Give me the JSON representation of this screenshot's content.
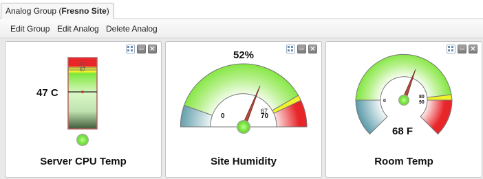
{
  "tab": {
    "prefix": "Analog Group (",
    "site": "Fresno Site",
    "suffix": ")"
  },
  "menu": {
    "edit_group": "Edit Group",
    "edit_analog": "Edit Analog",
    "delete_analog": "Delete Analog"
  },
  "colors": {
    "normal": "#7ee63a",
    "warning": "#f2f22a",
    "alarm": "#e8262a",
    "low": "#5a9aa8",
    "panel_border": "#c4c4c4"
  },
  "panels": [
    {
      "title": "Server CPU Temp",
      "value": "47 C",
      "reading": 47,
      "thresholds": {
        "warning": "67",
        "alarm": "70"
      },
      "icons": [
        "layout-icon",
        "minimize-icon",
        "close-icon"
      ]
    },
    {
      "title": "Site Humidity",
      "value": "52%",
      "reading": 52,
      "scale": {
        "min": "0",
        "low_mark": "67",
        "high_mark": "70"
      }
    },
    {
      "title": "Room Temp",
      "value": "68 F",
      "reading": 68,
      "scale": {
        "min": "0",
        "warning": "80",
        "alarm": "90"
      }
    }
  ]
}
